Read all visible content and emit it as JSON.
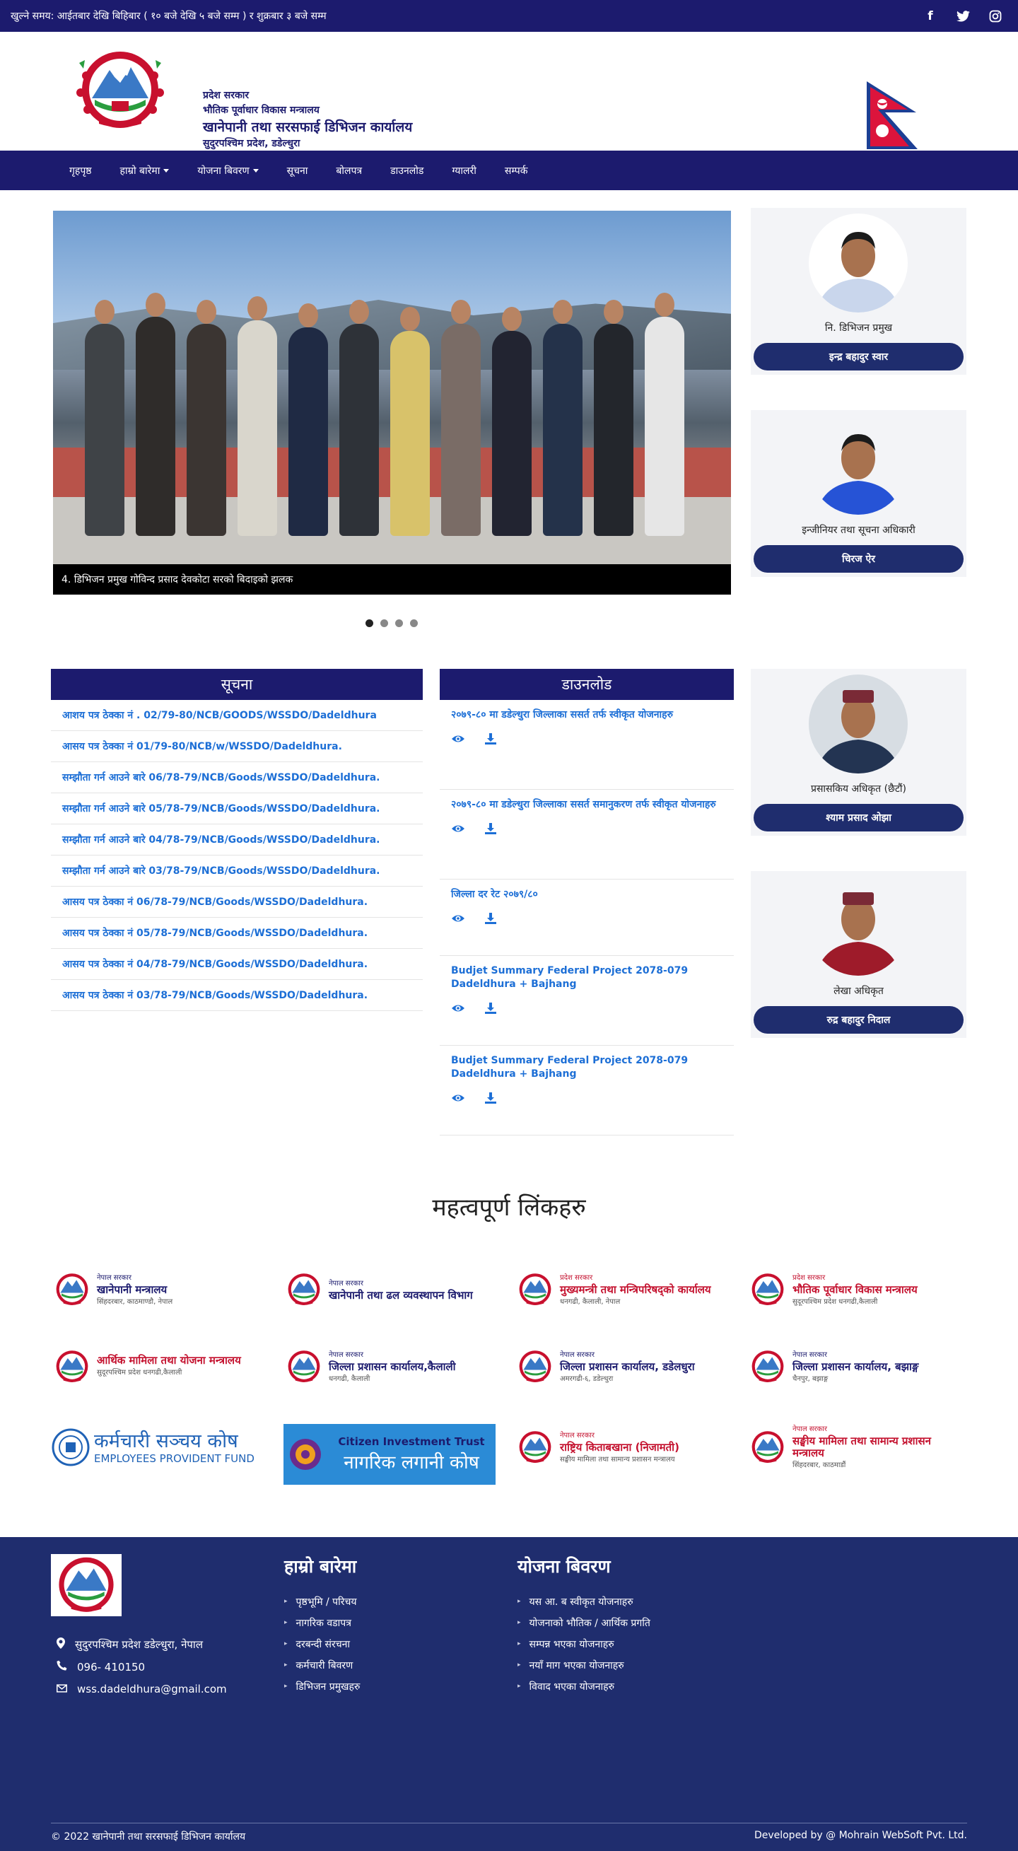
{
  "topbar": {
    "hours": "खुल्ने समय: आईतबार देखि बिहिबार ( १० बजे देखि ५ बजे सम्म ) र शुक्रबार ३ बजे सम्म",
    "social": [
      "facebook-icon",
      "twitter-icon",
      "instagram-icon"
    ]
  },
  "header": {
    "line1": "प्रदेश सरकार",
    "line2": "भौतिक पूर्वाधार विकास मन्त्रालय",
    "line3": "खानेपानी तथा सरसफाई डिभिजन कार्यालय",
    "line4": "सुदुरपश्चिम प्रदेश, डडेल्धुरा"
  },
  "nav": {
    "items": [
      {
        "label": "गृहपृष्ठ",
        "dropdown": false
      },
      {
        "label": "हाम्रो बारेमा",
        "dropdown": true
      },
      {
        "label": "योजना बिवरण",
        "dropdown": true
      },
      {
        "label": "सूचना",
        "dropdown": false
      },
      {
        "label": "बोलपत्र",
        "dropdown": false
      },
      {
        "label": "डाउनलोड",
        "dropdown": false
      },
      {
        "label": "ग्यालरी",
        "dropdown": false
      },
      {
        "label": "सम्पर्क",
        "dropdown": false
      }
    ]
  },
  "slider": {
    "caption": "4. डिभिजन प्रमुख गोविन्द प्रसाद देवकोटा सरको बिदाइको झलक",
    "slide_count": 4,
    "active_slide": 1
  },
  "staff": [
    {
      "title": "नि. डिभिजन प्रमुख",
      "name": "इन्द्र बहादुर स्वार"
    },
    {
      "title": "इन्जीनियर तथा सूचना अधिकारी",
      "name": "चिरज ऐर"
    },
    {
      "title": "प्रसासकिय अधिकृत (छैटौं)",
      "name": "श्याम प्रसाद ओझा"
    },
    {
      "title": "लेखा अधिकृत",
      "name": "रुद्र बहादुर निदाल"
    }
  ],
  "notice": {
    "heading": "सूचना",
    "items": [
      "आशय पत्र ठेक्का नं . 02/79-80/NCB/GOODS/WSSDO/Dadeldhura",
      "आसय पत्र ठेक्का नं 01/79-80/NCB/w/WSSDO/Dadeldhura.",
      "सम्झौता गर्न आउने बारे 06/78-79/NCB/Goods/WSSDO/Dadeldhura.",
      "सम्झौता गर्न आउने बारे 05/78-79/NCB/Goods/WSSDO/Dadeldhura.",
      "सम्झौता गर्न आउने बारे 04/78-79/NCB/Goods/WSSDO/Dadeldhura.",
      "सम्झौता गर्न आउने बारे 03/78-79/NCB/Goods/WSSDO/Dadeldhura.",
      "आसय पत्र ठेक्का नं 06/78-79/NCB/Goods/WSSDO/Dadeldhura.",
      "आसय पत्र ठेक्का नं 05/78-79/NCB/Goods/WSSDO/Dadeldhura.",
      "आसय पत्र ठेक्का नं 04/78-79/NCB/Goods/WSSDO/Dadeldhura.",
      "आसय पत्र ठेक्का नं 03/78-79/NCB/Goods/WSSDO/Dadeldhura."
    ]
  },
  "download": {
    "heading": "डाउनलोड",
    "items": [
      "२०७९-८० मा डडेल्धुरा जिल्लाका ससर्त तर्फ स्वीकृत योजनाहरु",
      "२०७९-८० मा डडेल्धुरा जिल्लाका ससर्त समानुकरण तर्फ स्वीकृत योजनाहरु",
      "जिल्ला दर रेट २०७९/८०",
      "Budjet Summary Federal Project 2078-079 Dadeldhura + Bajhang",
      "Budjet Summary Federal Project 2078-079 Dadeldhura + Bajhang"
    ]
  },
  "links": {
    "heading": "महत्वपूर्ण लिंकहरु",
    "logos": [
      {
        "small": "नेपाल सरकार",
        "main": "खानेपानी मन्त्रालय",
        "sub": "सिंहदरबार, काठमाण्डौ, नेपाल",
        "color": "#1c1b6e",
        "kind": "emblem"
      },
      {
        "small": "नेपाल सरकार",
        "main": "खानेपानी तथा ढल व्यवस्थापन विभाग",
        "sub": "",
        "color": "#1c1b6e",
        "kind": "emblem"
      },
      {
        "small": "प्रदेश सरकार",
        "main": "मुख्यमन्त्री तथा मन्त्रिपरिषद्को कार्यालय",
        "sub": "धनगढी, कैलाली, नेपाल",
        "color": "#c4122f",
        "kind": "emblem"
      },
      {
        "small": "प्रदेश सरकार",
        "main": "भौतिक पूर्वाधार विकास मन्त्रालय",
        "sub": "सुदूरपश्चिम प्रदेश धनगढी,कैलाली",
        "color": "#c4122f",
        "kind": "emblem"
      },
      {
        "small": "",
        "main": "आर्थिक मामिला तथा योजना मन्त्रालय",
        "sub": "सुदूरपश्चिम प्रदेश धनगढी,कैलाली",
        "color": "#c4122f",
        "kind": "emblem"
      },
      {
        "small": "नेपाल सरकार",
        "main": "जिल्ला प्रशासन कार्यालय,कैलाली",
        "sub": "धनगढी, कैलाली",
        "color": "#1c1b6e",
        "kind": "emblem"
      },
      {
        "small": "नेपाल सरकार",
        "main": "जिल्ला प्रशासन कार्यालय, डडेलधुरा",
        "sub": "अमरगढी-६, डडेल्धुरा",
        "color": "#1c1b6e",
        "kind": "emblem"
      },
      {
        "small": "नेपाल सरकार",
        "main": "जिल्ला प्रशासन कार्यालय, बझाङ्ग",
        "sub": "चैनपुर, बझाङ्ग",
        "color": "#1c1b6e",
        "kind": "emblem"
      },
      {
        "small": "",
        "main": "कर्मचारी सञ्चय कोष",
        "sub": "EMPLOYEES PROVIDENT FUND",
        "color": "#1f62b6",
        "kind": "epf"
      },
      {
        "small": "Citizen Investment Trust",
        "main": "नागरिक लगानी कोष",
        "sub": "",
        "color": "#ffffff",
        "kind": "cit"
      },
      {
        "small": "नेपाल सरकार",
        "main": "राष्ट्रिय किताबखाना (निजामती)",
        "sub": "सङ्घीय मामिला तथा सामान्य प्रशासन मन्त्रालय",
        "color": "#c4122f",
        "kind": "emblem"
      },
      {
        "small": "नेपाल सरकार",
        "main": "सङ्घीय मामिला तथा सामान्य प्रशासन मन्त्रालय",
        "sub": "सिंहदरबार, काठमाडौं",
        "color": "#c4122f",
        "kind": "emblem"
      }
    ]
  },
  "footer": {
    "address": "सुदुरपश्चिम प्रदेश डडेल्धुरा, नेपाल",
    "phone": "096- 410150",
    "email": "wss.dadeldhura@gmail.com",
    "about_heading": "हाम्रो बारेमा",
    "about_items": [
      "पृष्ठभूमि / परिचय",
      "नागरिक वडापत्र",
      "दरबन्दी संरचना",
      "कर्मचारी बिवरण",
      "डिभिजन प्रमुखहरु"
    ],
    "plan_heading": "योजना बिवरण",
    "plan_items": [
      "यस आ. ब स्वीकृत योजनाहरु",
      "योजनाको भौतिक / आर्थिक प्रगति",
      "सम्पन्न भएका योजनाहरु",
      "नयाँ माग भएका योजनाहरु",
      "विवाद भएका योजनाहरु"
    ],
    "copyright": "© 2022 खानेपानी तथा सरसफाई डिभिजन कार्यालय",
    "developer": "Developed by @ Mohrain WebSoft Pvt. Ltd."
  },
  "colors": {
    "primary": "#1c1b6e",
    "footer_bg": "#1f2d6e",
    "link": "#1d6fd6",
    "card_bg": "#f3f4f7"
  }
}
